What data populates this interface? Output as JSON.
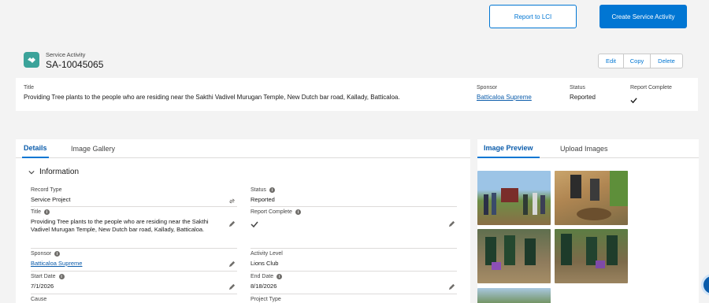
{
  "actions": {
    "report_label": "Report to LCI",
    "create_label": "Create Service Activity"
  },
  "record": {
    "type_label": "Service Activity",
    "name": "SA-10045065",
    "icon": "handshake-icon"
  },
  "record_actions": {
    "edit": "Edit",
    "copy": "Copy",
    "delete": "Delete"
  },
  "highlights": {
    "title_label": "Title",
    "title_value": "Providing Tree plants to the people who are residing near the Sakthi Vadivel Murugan Temple, New Dutch bar road, Kallady, Batticaloa.",
    "sponsor_label": "Sponsor",
    "sponsor_value": "Batticaloa Supreme",
    "status_label": "Status",
    "status_value": "Reported",
    "report_complete_label": "Report Complete"
  },
  "left_tabs": [
    "Details",
    "Image Gallery"
  ],
  "right_tabs": [
    "Image Preview",
    "Upload Images"
  ],
  "section": {
    "title": "Information"
  },
  "fields": {
    "record_type_label": "Record Type",
    "record_type_value": "Service Project",
    "status_label": "Status",
    "status_value": "Reported",
    "title_label": "Title",
    "title_value": "Providing Tree plants to the people who are residing near the Sakthi Vadivel Murugan Temple, New Dutch bar road, Kallady, Batticaloa.",
    "report_complete_label": "Report Complete",
    "sponsor_label": "Sponsor",
    "sponsor_value": "Batticaloa Supreme",
    "activity_level_label": "Activity Level",
    "activity_level_value": "Lions Club",
    "start_date_label": "Start Date",
    "start_date_value": "7/1/2026",
    "end_date_label": "End Date",
    "end_date_value": "8/18/2026",
    "cause_label": "Cause",
    "project_type_label": "Project Type"
  },
  "colors": {
    "brand": "#0176d3",
    "record_icon": "#3ba39a",
    "link": "#0b5cab"
  }
}
